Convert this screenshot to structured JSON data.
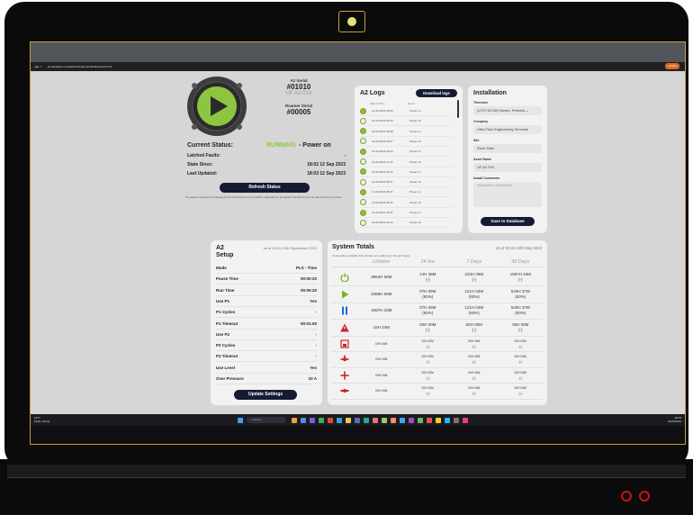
{
  "browser": {
    "url": "a2.autokdee.com/dashboard/pump/dashboard/A2-271",
    "profile_label": "Update"
  },
  "device": {
    "serial_label": "A2 Serial",
    "serial": "#01010",
    "model": "UF A2 010",
    "roamer_label": "Roamer Serial",
    "roamer": "#00005",
    "status_label": "Current Status:",
    "status_running": "RUNNING",
    "status_rest": "- Power on",
    "latched_label": "Latched Faults:",
    "latched_value": "-",
    "state_since_label": "State Since:",
    "state_since": "18:02 12 Sep 2023",
    "last_updated_label": "Last Updated:",
    "last_updated": "18:03 12 Sep 2023",
    "refresh_label": "Refresh Status",
    "note": "The status is refreshed by contacting the A2 via the Roamer using GSM/4G. Depending on the signal to the Roamer this may take some time to refresh."
  },
  "logs": {
    "title": "A2 Logs",
    "download_label": "Download logs",
    "col_date": "Date & Time",
    "col_event": "Event",
    "rows": [
      {
        "date": "12-09-2023 08:03",
        "event": "Power on",
        "on": true
      },
      {
        "date": "12-09-2023 08:00",
        "event": "Power off",
        "on": false
      },
      {
        "date": "12-09-2023 08:08",
        "event": "Power on",
        "on": true
      },
      {
        "date": "12-09-2023 08:07",
        "event": "Power off",
        "on": false
      },
      {
        "date": "12-09-2023 08:03",
        "event": "Power on",
        "on": true
      },
      {
        "date": "11-09-2023 12:30",
        "event": "Power off",
        "on": false
      },
      {
        "date": "11-09-2023 09:00",
        "event": "Power on",
        "on": true
      },
      {
        "date": "11-09-2023 08:07",
        "event": "Power off",
        "on": false
      },
      {
        "date": "11-09-2023 08:02",
        "event": "Power on",
        "on": true
      },
      {
        "date": "11-09-2023 08:00",
        "event": "Power off",
        "on": false
      },
      {
        "date": "11-09-2023 18:03",
        "event": "Power on",
        "on": true
      },
      {
        "date": "10-09-2023 22:04",
        "event": "Power off",
        "on": false
      }
    ]
  },
  "installation": {
    "title": "Installation",
    "timezone_label": "Timezone",
    "timezone": "(UTC+02:00) Harare, Pretoria",
    "company_label": "Company",
    "company": "Ultra Flow Engineering Services",
    "site_label": "Site",
    "site": "River Date",
    "asset_label": "Asset Name",
    "asset": "UF A2 010",
    "comments_label": "Install Comments",
    "comments_placeholder": "Installation comments",
    "save_label": "Save to Database"
  },
  "setup": {
    "title": "A2 Setup",
    "as_of": "as of 18:03 12th September 2023",
    "rows": [
      {
        "k": "Mode",
        "v": "PLS - Time"
      },
      {
        "k": "Pause Time",
        "v": "00:00:20"
      },
      {
        "k": "Run Time",
        "v": "00:00:20"
      },
      {
        "k": "Use P1",
        "v": "Yes"
      },
      {
        "k": "P1 Cycles",
        "v": "-"
      },
      {
        "k": "P1 Timeout",
        "v": "00:01:00"
      },
      {
        "k": "Use P2",
        "v": "-"
      },
      {
        "k": "P2 Cycles",
        "v": "-"
      },
      {
        "k": "P2 Timeout",
        "v": "-"
      },
      {
        "k": "Use Level",
        "v": "Yes"
      },
      {
        "k": "Over Pressure",
        "v": "10 A"
      }
    ],
    "update_label": "Update Settings"
  },
  "totals": {
    "title": "System Totals",
    "as_of": "as of 02:03 13th May 2023",
    "note": "(Totals will be available if the A2 has sent a daily log in the last 7days)",
    "headers": [
      "Lifetime",
      "24 hrs",
      "7 Days",
      "30 Days"
    ],
    "rows": [
      {
        "icon": "power-icon",
        "color": "#7db521",
        "cells": [
          "3954H 56M",
          "14H 38M\n(-)",
          "243H 09M\n(-)",
          "1087H 16M\n(-)"
        ]
      },
      {
        "icon": "play-icon",
        "color": "#7db521",
        "cells": [
          "2395H 59M",
          "07H 09M\n(50%)",
          "121H 04M\n(50%)",
          "543H 37M\n(50%)"
        ]
      },
      {
        "icon": "pause-icon",
        "color": "#1a6bd1",
        "cells": [
          "1557H 33M",
          "07H 09M\n(50%)",
          "121H 04M\n(50%)",
          "543H 37M\n(50%)"
        ]
      },
      {
        "icon": "alert-icon",
        "color": "#d2202a",
        "cells": [
          "15H 24M",
          "00H 00M\n(-)",
          "00H 00M\n(-)",
          "00H 00M\n(-)"
        ]
      },
      {
        "icon": "tank-icon",
        "color": "#d2202a",
        "cells": [
          "00H 00M",
          "00H 00M\n(-)",
          "00H 00M\n(-)",
          "00H 00M\n(-)"
        ]
      },
      {
        "icon": "valve-icon",
        "color": "#d2202a",
        "cells": [
          "00H 00M",
          "00H 00M\n(-)",
          "00H 00M\n(-)",
          "00H 00M\n(-)"
        ]
      },
      {
        "icon": "valve-alt-icon",
        "color": "#d2202a",
        "cells": [
          "00H 00M",
          "00H 00M\n(-)",
          "00H 00M\n(-)",
          "00H 00M\n(-)"
        ]
      },
      {
        "icon": "pipe-icon",
        "color": "#d2202a",
        "cells": [
          "00H 00M",
          "00H 00M\n(-)",
          "00H 00M\n(-)",
          "00H 00M\n(-)"
        ]
      }
    ]
  },
  "taskbar": {
    "weather": "12°C",
    "weather_sub": "Partly cloudy",
    "search": "Search",
    "clock": "18:03",
    "date": "2023/09/12"
  }
}
